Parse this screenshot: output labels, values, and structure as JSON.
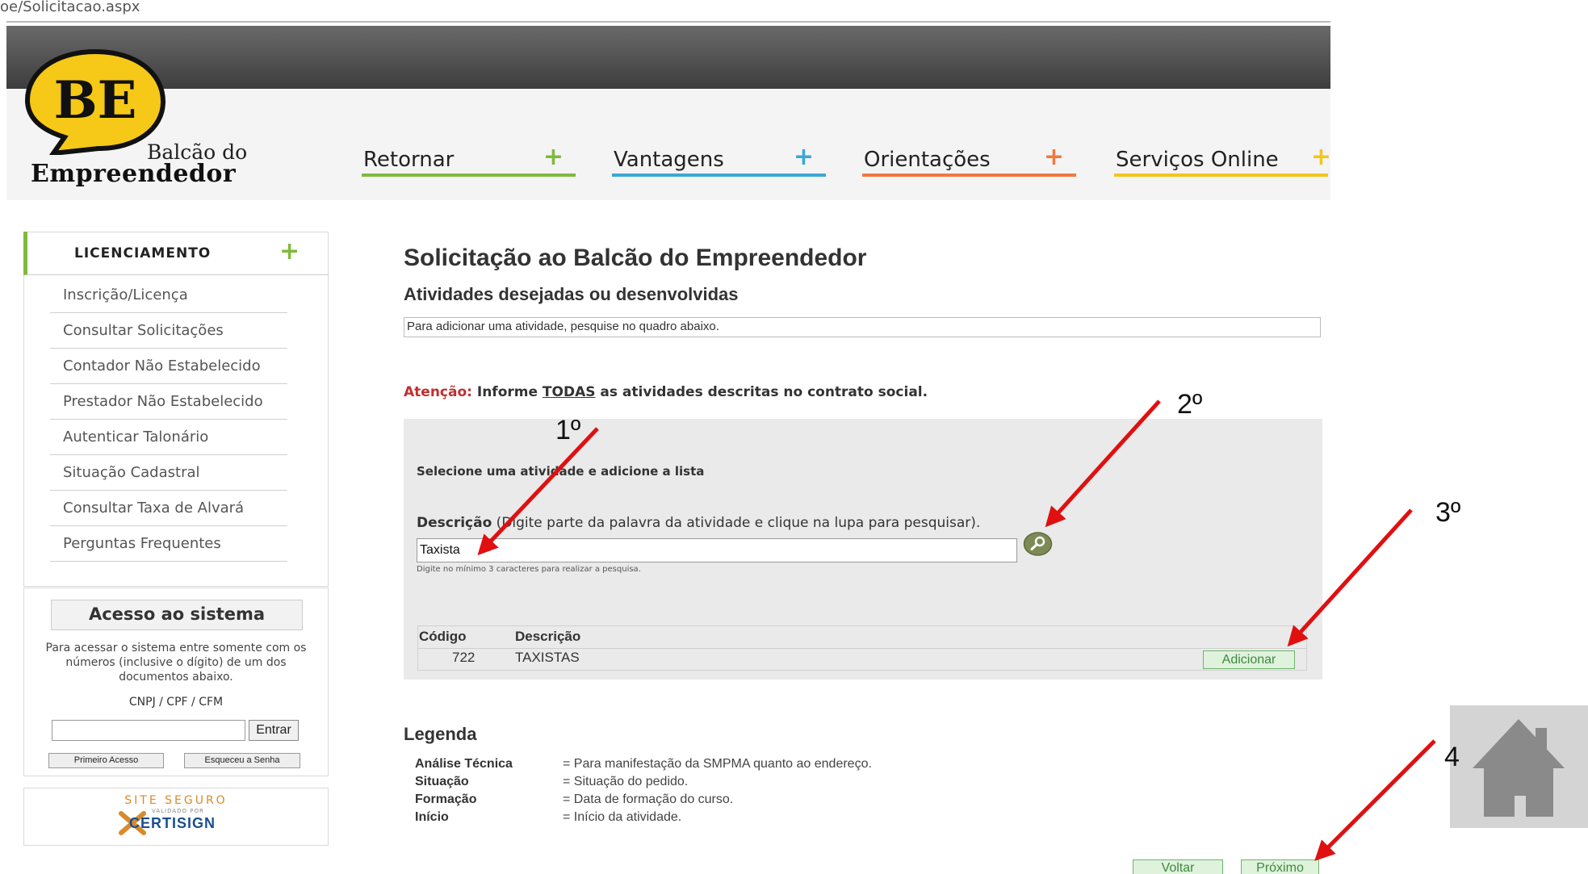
{
  "browser": {
    "url_fragment": "oe/Solicitacao.aspx"
  },
  "logo": {
    "mark": "BE",
    "line1": "Balcão do",
    "line2": "Empreendedor"
  },
  "nav": [
    {
      "label": "Retornar",
      "plus": "+",
      "color": "#7fba3c"
    },
    {
      "label": "Vantagens",
      "plus": "+",
      "color": "#3aa7d6"
    },
    {
      "label": "Orientações",
      "plus": "+",
      "color": "#ef7a3d"
    },
    {
      "label": "Serviços Online",
      "plus": "+",
      "color": "#f4c51c"
    }
  ],
  "sidebar": {
    "title": "LICENCIAMENTO",
    "plus": "+",
    "items": [
      "Inscrição/Licença",
      "Consultar Solicitações",
      "Contador Não Estabelecido",
      "Prestador Não Estabelecido",
      "Autenticar Talonário",
      "Situação Cadastral",
      "Consultar Taxa de Alvará",
      "Perguntas Frequentes"
    ]
  },
  "access": {
    "title": "Acesso ao sistema",
    "description": "Para acessar o sistema entre somente com os números (inclusive o dígito) de um dos documentos abaixo.",
    "docs": "CNPJ / CPF / CFM",
    "input_value": "",
    "enter_label": "Entrar",
    "first_access_label": "Primeiro Acesso",
    "forgot_label": "Esqueceu a Senha"
  },
  "seal": {
    "line1": "SITE SEGURO",
    "small": "VALIDADO POR",
    "brand": "CERTISIGN"
  },
  "main": {
    "title": "Solicitação ao Balcão do Empreendedor",
    "subtitle": "Atividades desejadas ou desenvolvidas",
    "info_box": "Para adicionar uma atividade, pesquise no quadro abaixo.",
    "attention_prefix": "Atenção:",
    "attention_pre": " Informe ",
    "attention_emph": "TODAS",
    "attention_post": " as atividades descritas no contrato social.",
    "select_title": "Selecione uma atividade e adicione a lista",
    "desc_label_bold": "Descrição",
    "desc_label_rest": " (Digite parte da palavra da atividade e clique na lupa para pesquisar).",
    "desc_value": "Taxista",
    "hint": "Digite no mínimo 3 caracteres para realizar a pesquisa.",
    "table": {
      "headers": [
        "Código",
        "Descrição"
      ],
      "rows": [
        {
          "code": "722",
          "desc": "TAXISTAS",
          "action": "Adicionar"
        }
      ]
    },
    "legend_title": "Legenda",
    "legend": [
      {
        "term": "Análise Técnica",
        "def": "= Para manifestação da SMPMA quanto ao endereço."
      },
      {
        "term": "Situação",
        "def": "= Situação do pedido."
      },
      {
        "term": "Formação",
        "def": "= Data de formação do curso."
      },
      {
        "term": "Início",
        "def": "= Início da atividade."
      }
    ],
    "back_label": "Voltar",
    "next_label": "Próximo"
  },
  "annotations": {
    "step1": "1º",
    "step2": "2º",
    "step3": "3º",
    "step4": "4"
  },
  "colors": {
    "accent_green": "#7fba3c",
    "annotation_red": "#e01010",
    "logo_yellow": "#f6c817"
  },
  "icons": {
    "search": "search-icon",
    "home": "home-icon"
  }
}
